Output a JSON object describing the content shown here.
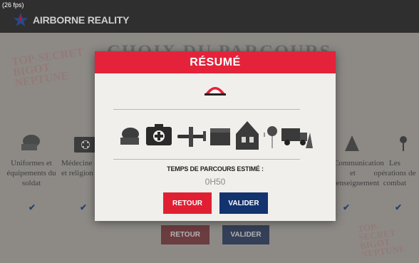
{
  "fps": "(26 fps)",
  "app": {
    "title": "AIRBORNE REALITY"
  },
  "background": {
    "stamp_top": "TOP-SECRET BIGOT NEPTUNE",
    "stamp_bottom": "TOP-SECRET BIGOT NEPTUNE",
    "title": "CHOIX DU PARCOURS",
    "categories": [
      {
        "label": "Uniformes et équipements du soldat",
        "icon": "helmet-icon",
        "checked": true
      },
      {
        "label": "Médecine et religion",
        "icon": "medical-case-icon",
        "checked": true
      },
      {
        "label": "Communication et renseignement",
        "icon": "radio-icon",
        "checked": true
      },
      {
        "label": "Les opérations de combat",
        "icon": "parachute-icon",
        "checked": true
      }
    ],
    "buttons": {
      "retour": "RETOUR",
      "valider": "VALIDER"
    }
  },
  "modal": {
    "title": "RÉSUMÉ",
    "icons": [
      "helmet-icon",
      "medical-case-icon",
      "airplane-icon",
      "chest-icon",
      "house-icon",
      "parachute-icon",
      "truck-icon",
      "antenna-icon"
    ],
    "estimated_label": "TEMPS DE PARCOURS ESTIMÉ :",
    "estimated_value": "0H50",
    "retour_label": "RETOUR",
    "valider_label": "VALIDER"
  },
  "colors": {
    "accent_red": "#e4233a",
    "accent_navy": "#13336f",
    "check_blue": "#1f3f82"
  }
}
